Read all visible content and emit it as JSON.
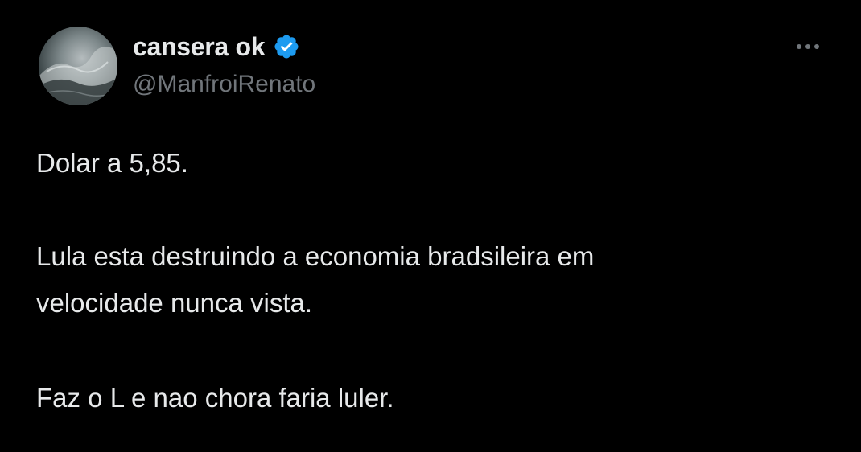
{
  "author": {
    "display_name": "cansera ok",
    "handle": "@ManfroiRenato",
    "verified": true,
    "verified_icon": "verified-badge-icon",
    "avatar_icon": "avatar-wave-photo"
  },
  "menu": {
    "icon": "more-horizontal-icon"
  },
  "tweet": {
    "lines": [
      "Dolar a 5,85.",
      "Lula esta destruindo a economia bradsileira em",
      "velocidade nunca vista.",
      "Faz o L e nao chora faria luler."
    ]
  },
  "colors": {
    "background": "#000000",
    "text_primary": "#e7e9ea",
    "text_secondary": "#71767b",
    "verified_blue": "#1d9bf0"
  }
}
